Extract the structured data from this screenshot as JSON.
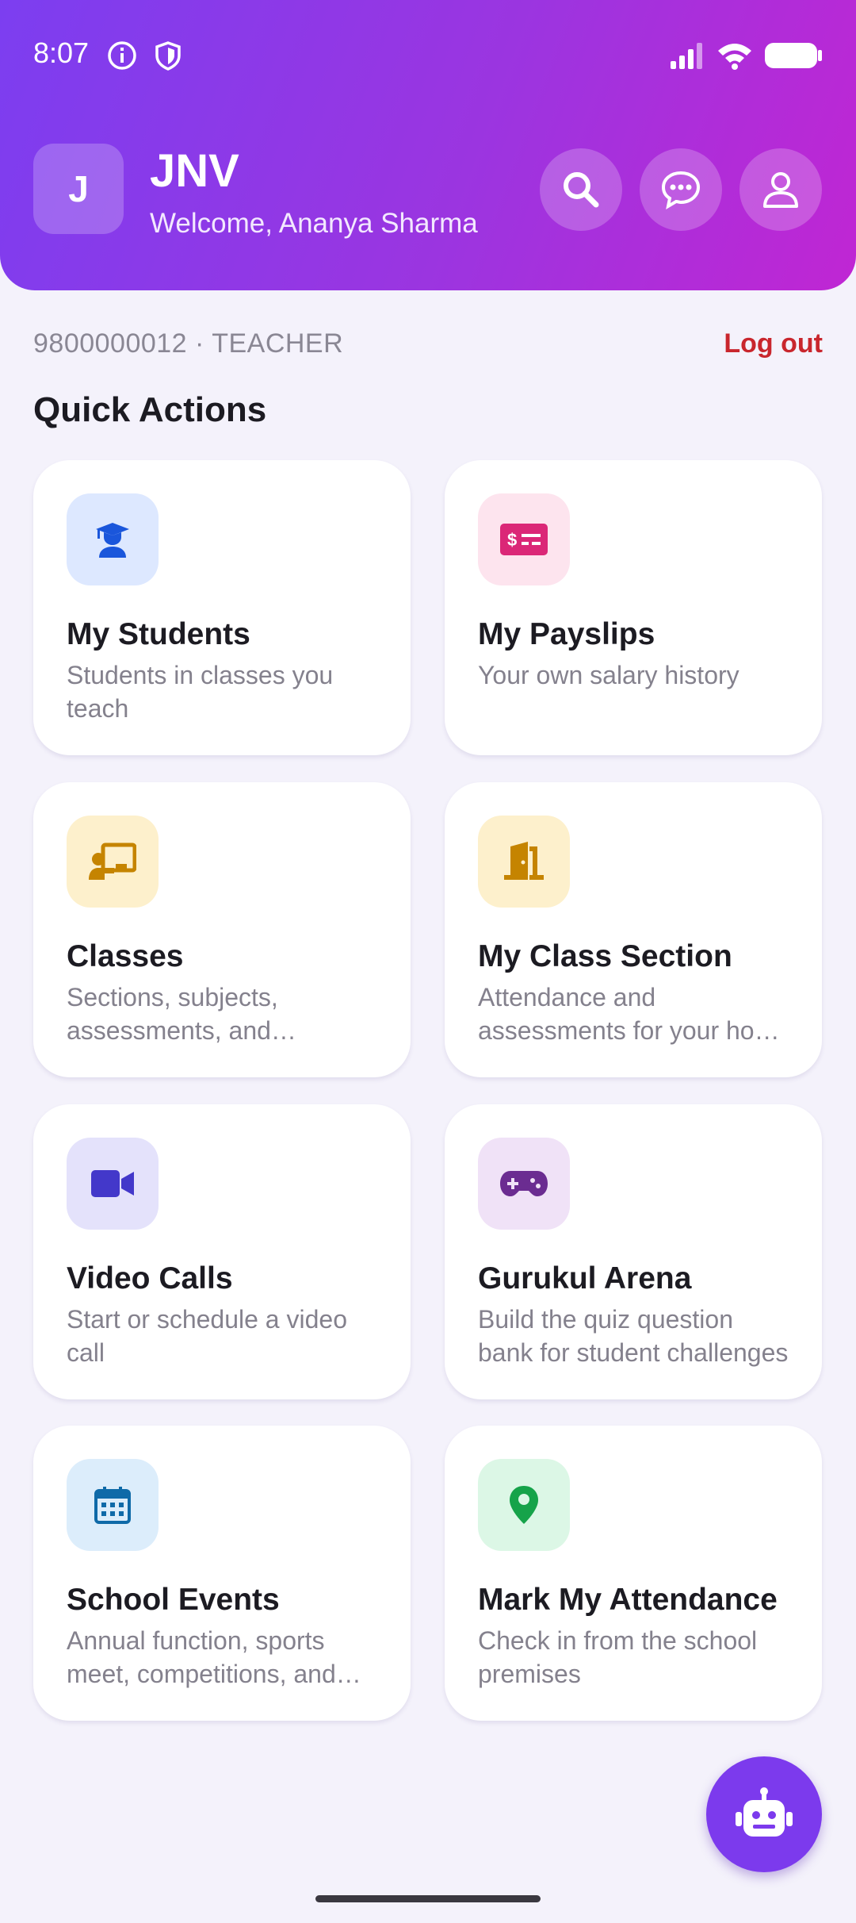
{
  "status_bar": {
    "time": "8:07"
  },
  "header": {
    "avatar_letter": "J",
    "title": "JNV",
    "welcome": "Welcome, Ananya Sharma"
  },
  "account": {
    "phone_role": "9800000012 · TEACHER",
    "logout": "Log out"
  },
  "quick_actions": {
    "title": "Quick Actions",
    "items": [
      {
        "title": "My Students",
        "desc": "Students in classes you teach",
        "icon": "graduate-icon",
        "icon_bg": "#dde8ff",
        "icon_color": "#1a56db"
      },
      {
        "title": "My Payslips",
        "desc": "Your own salary history",
        "icon": "payslip-icon",
        "icon_bg": "#fde4ee",
        "icon_color": "#db2777"
      },
      {
        "title": "Classes",
        "desc": "Sections, subjects, assessments, and attendance",
        "icon": "teacher-board-icon",
        "icon_bg": "#fdf0cc",
        "icon_color": "#c58400"
      },
      {
        "title": "My Class Section",
        "desc": "Attendance and assessments for your home section",
        "icon": "door-icon",
        "icon_bg": "#fdf0cc",
        "icon_color": "#c58400"
      },
      {
        "title": "Video Calls",
        "desc": "Start or schedule a video call",
        "icon": "video-camera-icon",
        "icon_bg": "#e4e2fb",
        "icon_color": "#4338ca"
      },
      {
        "title": "Gurukul Arena",
        "desc": "Build the quiz question bank for student challenges",
        "icon": "gamepad-icon",
        "icon_bg": "#f0e2f7",
        "icon_color": "#6b2c91"
      },
      {
        "title": "School Events",
        "desc": "Annual function, sports meet, competitions, and more",
        "icon": "calendar-icon",
        "icon_bg": "#dcedfb",
        "icon_color": "#0f6aa8"
      },
      {
        "title": "Mark My Attendance",
        "desc": "Check in from the school premises",
        "icon": "location-pin-icon",
        "icon_bg": "#dcf7e6",
        "icon_color": "#16a34a"
      }
    ]
  },
  "colors": {
    "accent": "#7c3aed",
    "logout": "#c9262d"
  }
}
